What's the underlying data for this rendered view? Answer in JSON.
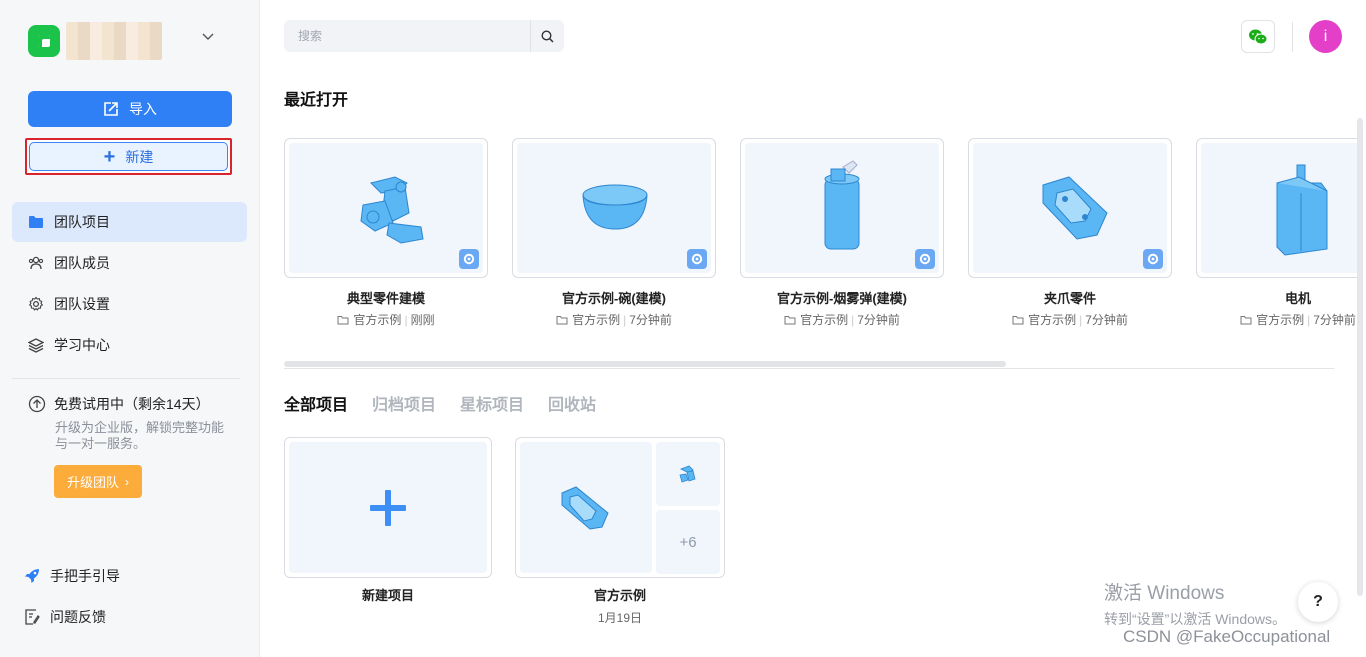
{
  "sidebar": {
    "import_label": "导入",
    "new_label": "新建",
    "nav": [
      {
        "label": "团队项目",
        "icon": "folder-icon",
        "active": true
      },
      {
        "label": "团队成员",
        "icon": "members-icon"
      },
      {
        "label": "团队设置",
        "icon": "gear-icon"
      },
      {
        "label": "学习中心",
        "icon": "layers-icon"
      }
    ],
    "trial_title": "免费试用中（剩余14天）",
    "trial_desc": "升级为企业版，解锁完整功能与一对一服务。",
    "upgrade_label": "升级团队",
    "guide_label": "手把手引导",
    "feedback_label": "问题反馈"
  },
  "search": {
    "placeholder": "搜索"
  },
  "recent": {
    "title": "最近打开",
    "items": [
      {
        "name": "典型零件建模",
        "folder": "官方示例",
        "time": "刚刚"
      },
      {
        "name": "官方示例-碗(建模)",
        "folder": "官方示例",
        "time": "7分钟前"
      },
      {
        "name": "官方示例-烟雾弹(建模)",
        "folder": "官方示例",
        "time": "7分钟前"
      },
      {
        "name": "夹爪零件",
        "folder": "官方示例",
        "time": "7分钟前"
      },
      {
        "name": "电机",
        "folder": "官方示例",
        "time": "7分钟前"
      }
    ]
  },
  "tabs": [
    "全部项目",
    "归档项目",
    "星标项目",
    "回收站"
  ],
  "projects": {
    "new_label": "新建项目",
    "items": [
      {
        "name": "官方示例",
        "date": "1月19日",
        "more": "+6"
      }
    ]
  },
  "avatar_letter": "i",
  "overlay": {
    "activate_title": "激活 Windows",
    "activate_sub": "转到“设置”以激活 Windows。",
    "help": "?",
    "watermark": "CSDN @FakeOccupational"
  },
  "colors": {
    "primary": "#2f7ff5",
    "upgrade": "#fbac3b",
    "avatar": "#e43fc9",
    "model_blue": "#5bb6f4"
  }
}
